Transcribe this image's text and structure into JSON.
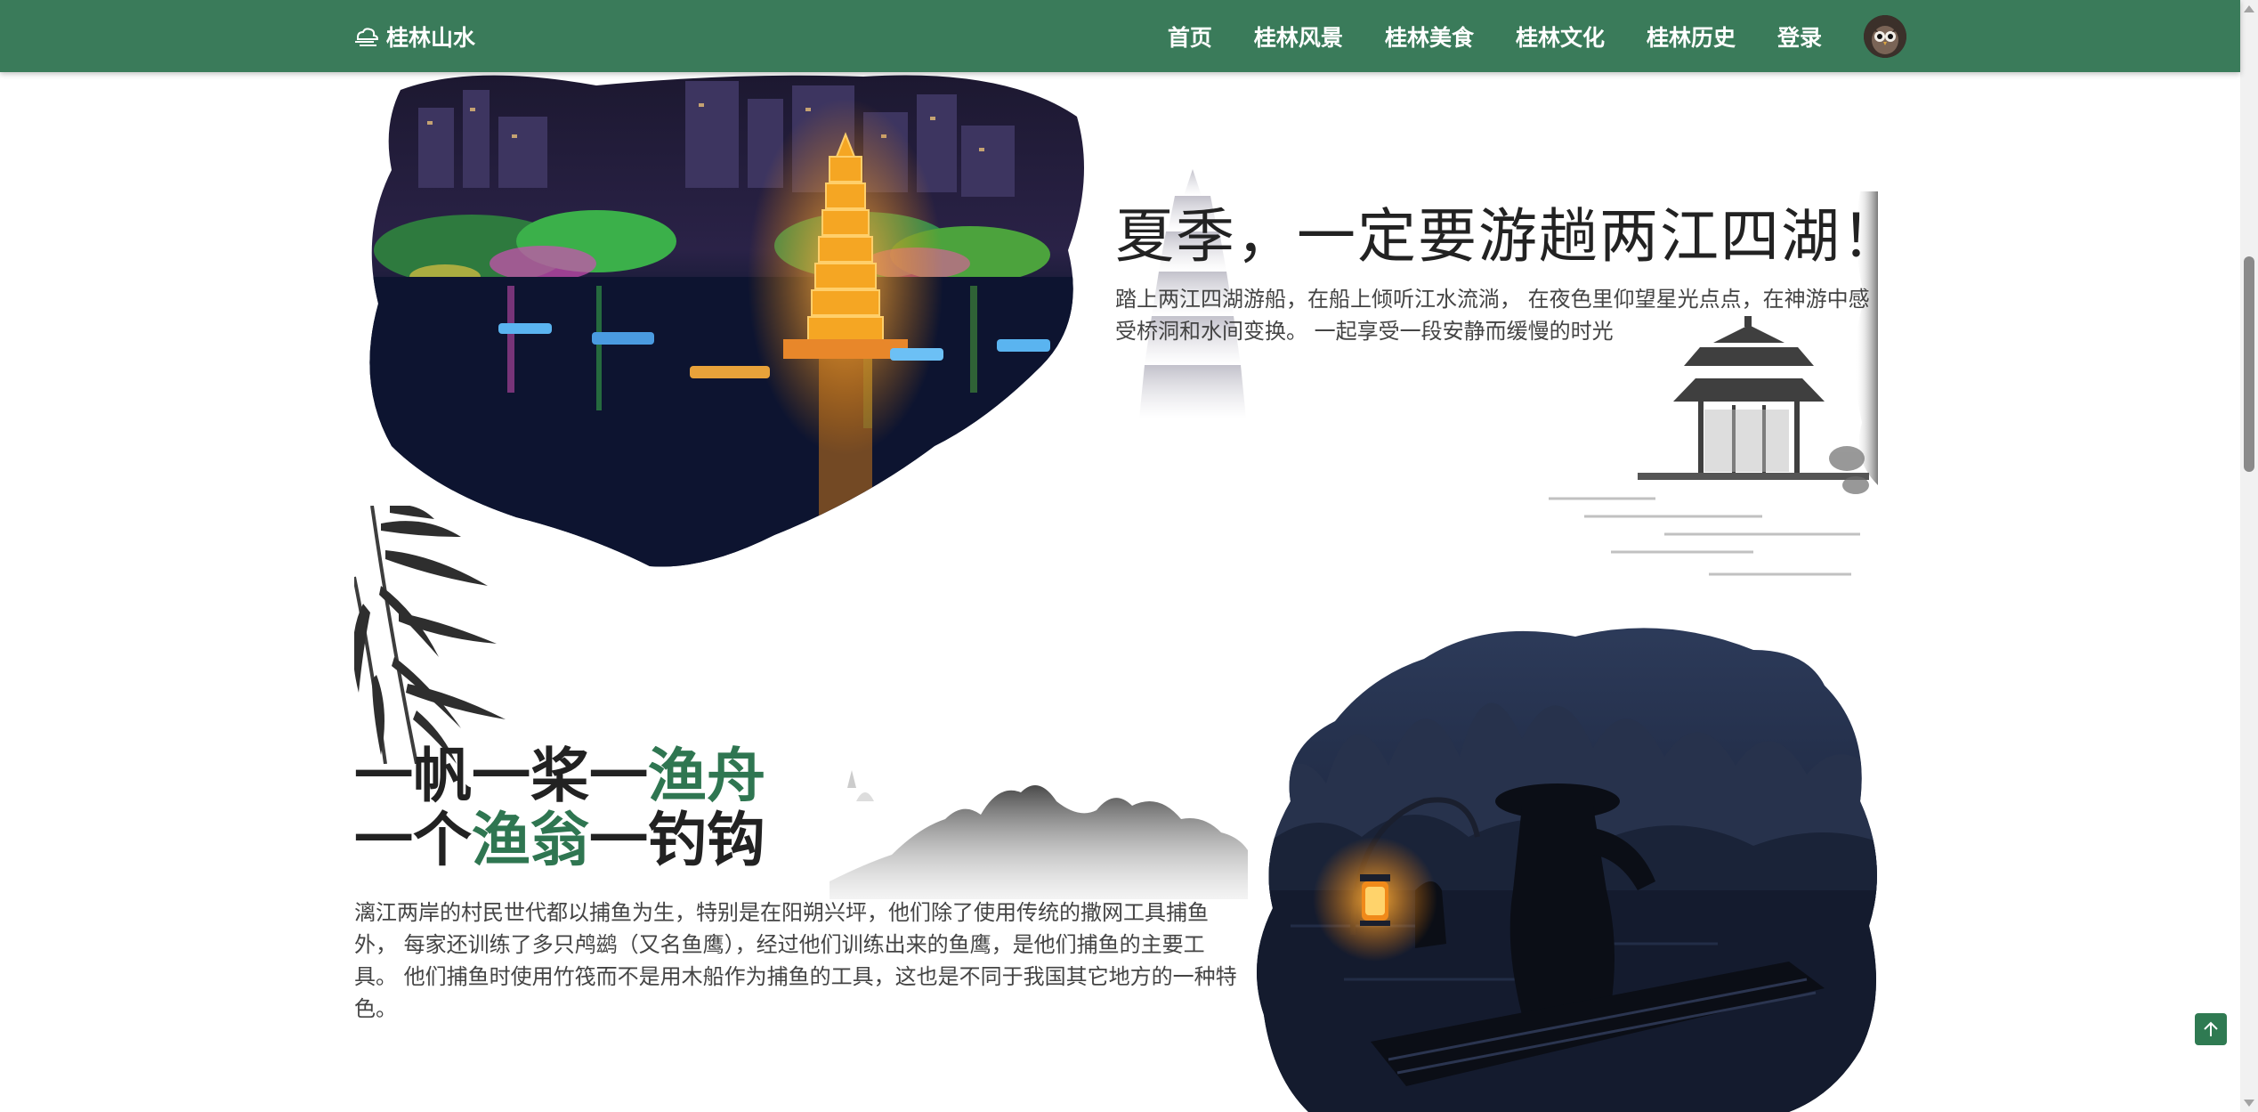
{
  "header": {
    "brand_icon": "cloud-logo-icon",
    "brand": "桂林山水",
    "nav": [
      {
        "label": "首页"
      },
      {
        "label": "桂林风景"
      },
      {
        "label": "桂林美食"
      },
      {
        "label": "桂林文化"
      },
      {
        "label": "桂林历史"
      },
      {
        "label": "登录"
      }
    ],
    "avatar_icon": "owl-avatar-icon"
  },
  "section1": {
    "title": "夏季，一定要游趟两江四湖！",
    "desc": "踏上两江四湖游船，在船上倾听江水流淌， 在夜色里仰望星光点点，在神游中感受桥洞和水间变换。 一起享受一段安静而缓慢的时光",
    "image_icon": "night-pagoda-lake-image"
  },
  "section2": {
    "title_line1_a": "一帆一桨一",
    "title_line1_b": "渔舟",
    "title_line2_a": "一个",
    "title_line2_b": "渔翁",
    "title_line2_c": "一钓钩",
    "desc": "漓江两岸的村民世代都以捕鱼为生，特别是在阳朔兴坪，他们除了使用传统的撒网工具捕鱼外， 每家还训练了多只鸬鹚（又名鱼鹰），经过他们训练出来的鱼鹰，是他们捕鱼的主要工具。 他们捕鱼时使用竹筏而不是用木船作为捕鱼的工具，这也是不同于我国其它地方的一种特色。",
    "image_icon": "fisherman-lantern-image"
  },
  "colors": {
    "header_bg": "#3a7b5a",
    "accent_green": "#2f7651",
    "back_top_bg": "#2f7a52"
  },
  "back_to_top_icon": "arrow-up-icon"
}
